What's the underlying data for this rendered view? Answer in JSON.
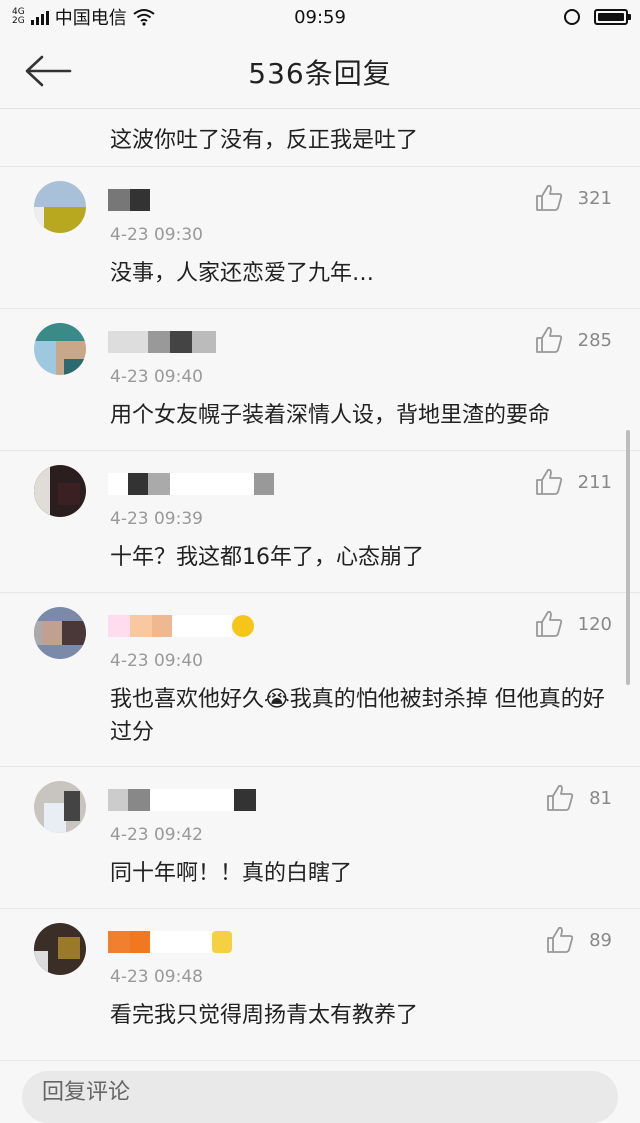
{
  "status_bar": {
    "network": "4G",
    "network_sub": "2G",
    "carrier": "中国电信",
    "time": "09:59",
    "battery_level": 1.0
  },
  "header": {
    "title": "536条回复"
  },
  "top_comment": {
    "text": "这波你吐了没有，反正我是吐了"
  },
  "comments": [
    {
      "time": "4-23 09:30",
      "likes": "321",
      "text": "没事，人家还恋爱了九年…"
    },
    {
      "time": "4-23 09:40",
      "likes": "285",
      "text": "用个女友幌子装着深情人设，背地里渣的要命"
    },
    {
      "time": "4-23 09:39",
      "likes": "211",
      "text": "十年？我这都16年了，心态崩了"
    },
    {
      "time": "4-23 09:40",
      "likes": "120",
      "text": "我也喜欢他好久😭我真的怕他被封杀掉 但他真的好过分"
    },
    {
      "time": "4-23 09:42",
      "likes": "81",
      "text": "同十年啊！！真的白瞎了"
    },
    {
      "time": "4-23 09:48",
      "likes": "89",
      "text": "看完我只觉得周扬青太有教养了"
    }
  ],
  "reply_bar": {
    "placeholder": "回复评论"
  },
  "icons": {
    "back": "arrow-left-icon",
    "like": "thumbs-up-icon",
    "alarm": "alarm-icon",
    "wifi": "wifi-icon",
    "battery": "battery-icon"
  }
}
